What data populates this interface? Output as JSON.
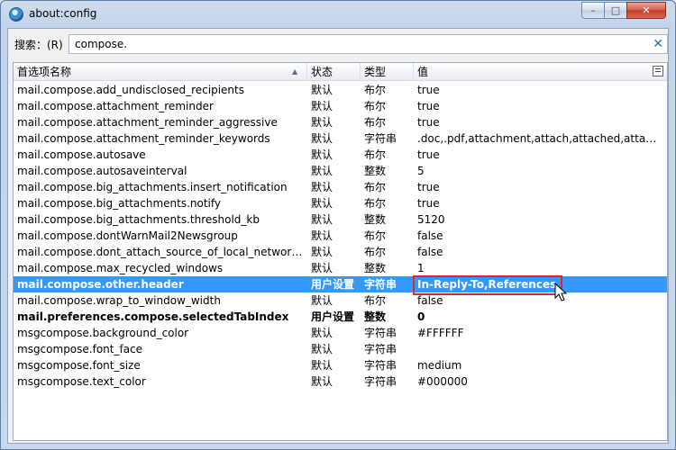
{
  "window": {
    "title": "about:config",
    "minimize_label": "–",
    "maximize_label": "□",
    "close_label": "✕"
  },
  "search": {
    "label": "搜索：(R)",
    "value": "compose.",
    "clear_icon": "✕"
  },
  "columns": {
    "name": "首选项名称",
    "state": "状态",
    "type": "类型",
    "value": "值",
    "sort_indicator": "▲"
  },
  "rows": [
    {
      "name": "mail.compose.add_undisclosed_recipients",
      "state": "默认",
      "type": "布尔",
      "value": "true"
    },
    {
      "name": "mail.compose.attachment_reminder",
      "state": "默认",
      "type": "布尔",
      "value": "true"
    },
    {
      "name": "mail.compose.attachment_reminder_aggressive",
      "state": "默认",
      "type": "布尔",
      "value": "true"
    },
    {
      "name": "mail.compose.attachment_reminder_keywords",
      "state": "默认",
      "type": "字符串",
      "value": ".doc,.pdf,attachment,attach,attached,attaching..."
    },
    {
      "name": "mail.compose.autosave",
      "state": "默认",
      "type": "布尔",
      "value": "true"
    },
    {
      "name": "mail.compose.autosaveinterval",
      "state": "默认",
      "type": "整数",
      "value": "5"
    },
    {
      "name": "mail.compose.big_attachments.insert_notification",
      "state": "默认",
      "type": "布尔",
      "value": "true"
    },
    {
      "name": "mail.compose.big_attachments.notify",
      "state": "默认",
      "type": "布尔",
      "value": "true"
    },
    {
      "name": "mail.compose.big_attachments.threshold_kb",
      "state": "默认",
      "type": "整数",
      "value": "5120"
    },
    {
      "name": "mail.compose.dontWarnMail2Newsgroup",
      "state": "默认",
      "type": "布尔",
      "value": "false"
    },
    {
      "name": "mail.compose.dont_attach_source_of_local_network_li...",
      "state": "默认",
      "type": "布尔",
      "value": "false"
    },
    {
      "name": "mail.compose.max_recycled_windows",
      "state": "默认",
      "type": "整数",
      "value": "1"
    },
    {
      "name": "mail.compose.other.header",
      "state": "用户设置",
      "type": "字符串",
      "value": "In-Reply-To,References",
      "modified": true,
      "selected": true
    },
    {
      "name": "mail.compose.wrap_to_window_width",
      "state": "默认",
      "type": "布尔",
      "value": "false"
    },
    {
      "name": "mail.preferences.compose.selectedTabIndex",
      "state": "用户设置",
      "type": "整数",
      "value": "0",
      "modified": true
    },
    {
      "name": "msgcompose.background_color",
      "state": "默认",
      "type": "字符串",
      "value": "#FFFFFF"
    },
    {
      "name": "msgcompose.font_face",
      "state": "默认",
      "type": "字符串",
      "value": ""
    },
    {
      "name": "msgcompose.font_size",
      "state": "默认",
      "type": "字符串",
      "value": "medium"
    },
    {
      "name": "msgcompose.text_color",
      "state": "默认",
      "type": "字符串",
      "value": "#000000"
    }
  ],
  "colors": {
    "selection": "#3399ff",
    "highlight_box": "#e0262a"
  }
}
